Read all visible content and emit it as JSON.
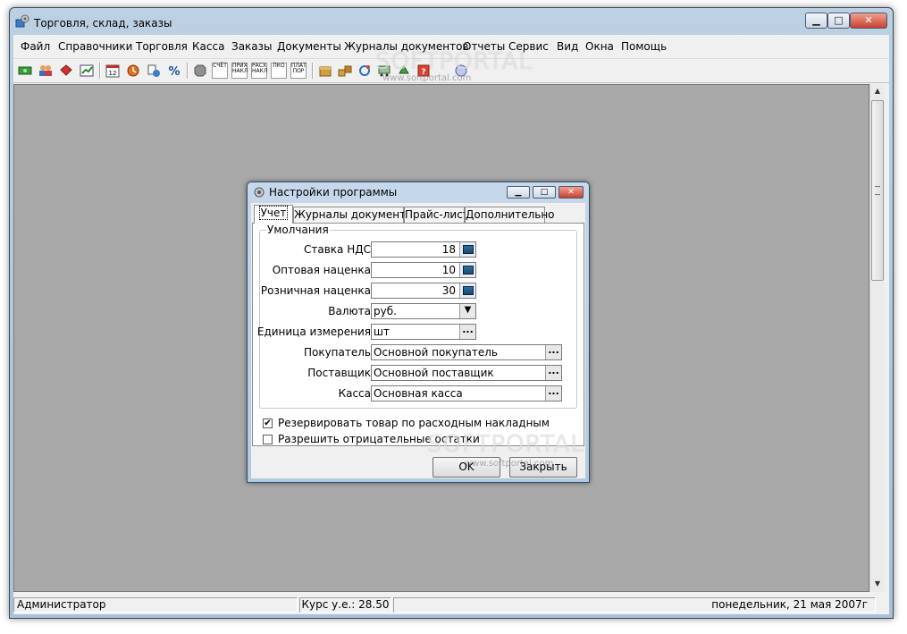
{
  "window": {
    "title": "Торговля, склад, заказы",
    "min_glyph": "▁",
    "max_glyph": "□",
    "close_glyph": "✕"
  },
  "menu": [
    "Файл",
    "Справочники",
    "Торговля",
    "Касса",
    "Заказы",
    "Документы",
    "Журналы документов",
    "Отчеты",
    "Сервис",
    "Вид",
    "Окна",
    "Помощь"
  ],
  "toolbar": {
    "icons": [
      "money-icon",
      "users-icon",
      "goods-icon",
      "chart-icon",
      "calendar-icon",
      "warehouse-icon",
      "basket-icon",
      "discount-icon",
      "stop-icon",
      "invoice-icon",
      "receipt-icon",
      "expense-icon",
      "cash-in-icon",
      "payment-icon",
      "box-icon",
      "boxes-icon",
      "refresh-icon",
      "cart-icon",
      "disk-icon",
      "help-icon",
      "about-icon"
    ],
    "doc_labels": [
      "СЧЁТ",
      "ПРИХ НАКЛ",
      "РАСХ НАКЛ",
      "ПКО",
      "ПЛАТ ПОР"
    ]
  },
  "watermark": {
    "brand": "SOFTPORTAL",
    "site": "www.softportal.com"
  },
  "dialog": {
    "title": "Настройки программы",
    "tabs": [
      "Учет",
      "Журналы документов",
      "Прайс-лист",
      "Дополнительно"
    ],
    "group_title": "Умолчания",
    "fields": {
      "vat": {
        "label": "Ставка НДС",
        "value": "18"
      },
      "wholesale": {
        "label": "Оптовая наценка",
        "value": "10"
      },
      "retail": {
        "label": "Розничная наценка",
        "value": "30"
      },
      "currency": {
        "label": "Валюта",
        "value": "руб."
      },
      "unit": {
        "label": "Единица измерения",
        "value": "шт"
      },
      "buyer": {
        "label": "Покупатель",
        "value": "Основной покупатель"
      },
      "supplier": {
        "label": "Поставщик",
        "value": "Основной поставщик"
      },
      "cashbox": {
        "label": "Касса",
        "value": "Основная касса"
      }
    },
    "checkboxes": {
      "reserve": {
        "label": "Резервировать товар по расходным накладным",
        "checked": true
      },
      "negative": {
        "label": "Разрешить отрицательные остатки",
        "checked": false
      }
    },
    "check_glyph": "✔",
    "ellipsis": "...",
    "dropdown_arrow": "▼",
    "ok": "OK",
    "close": "Закрыть"
  },
  "scroll": {
    "up": "▲",
    "down": "▼"
  },
  "status": {
    "user": "Администратор",
    "rate": "Курс у.е.: 28.50",
    "date": "понедельник, 21 мая 2007г"
  }
}
